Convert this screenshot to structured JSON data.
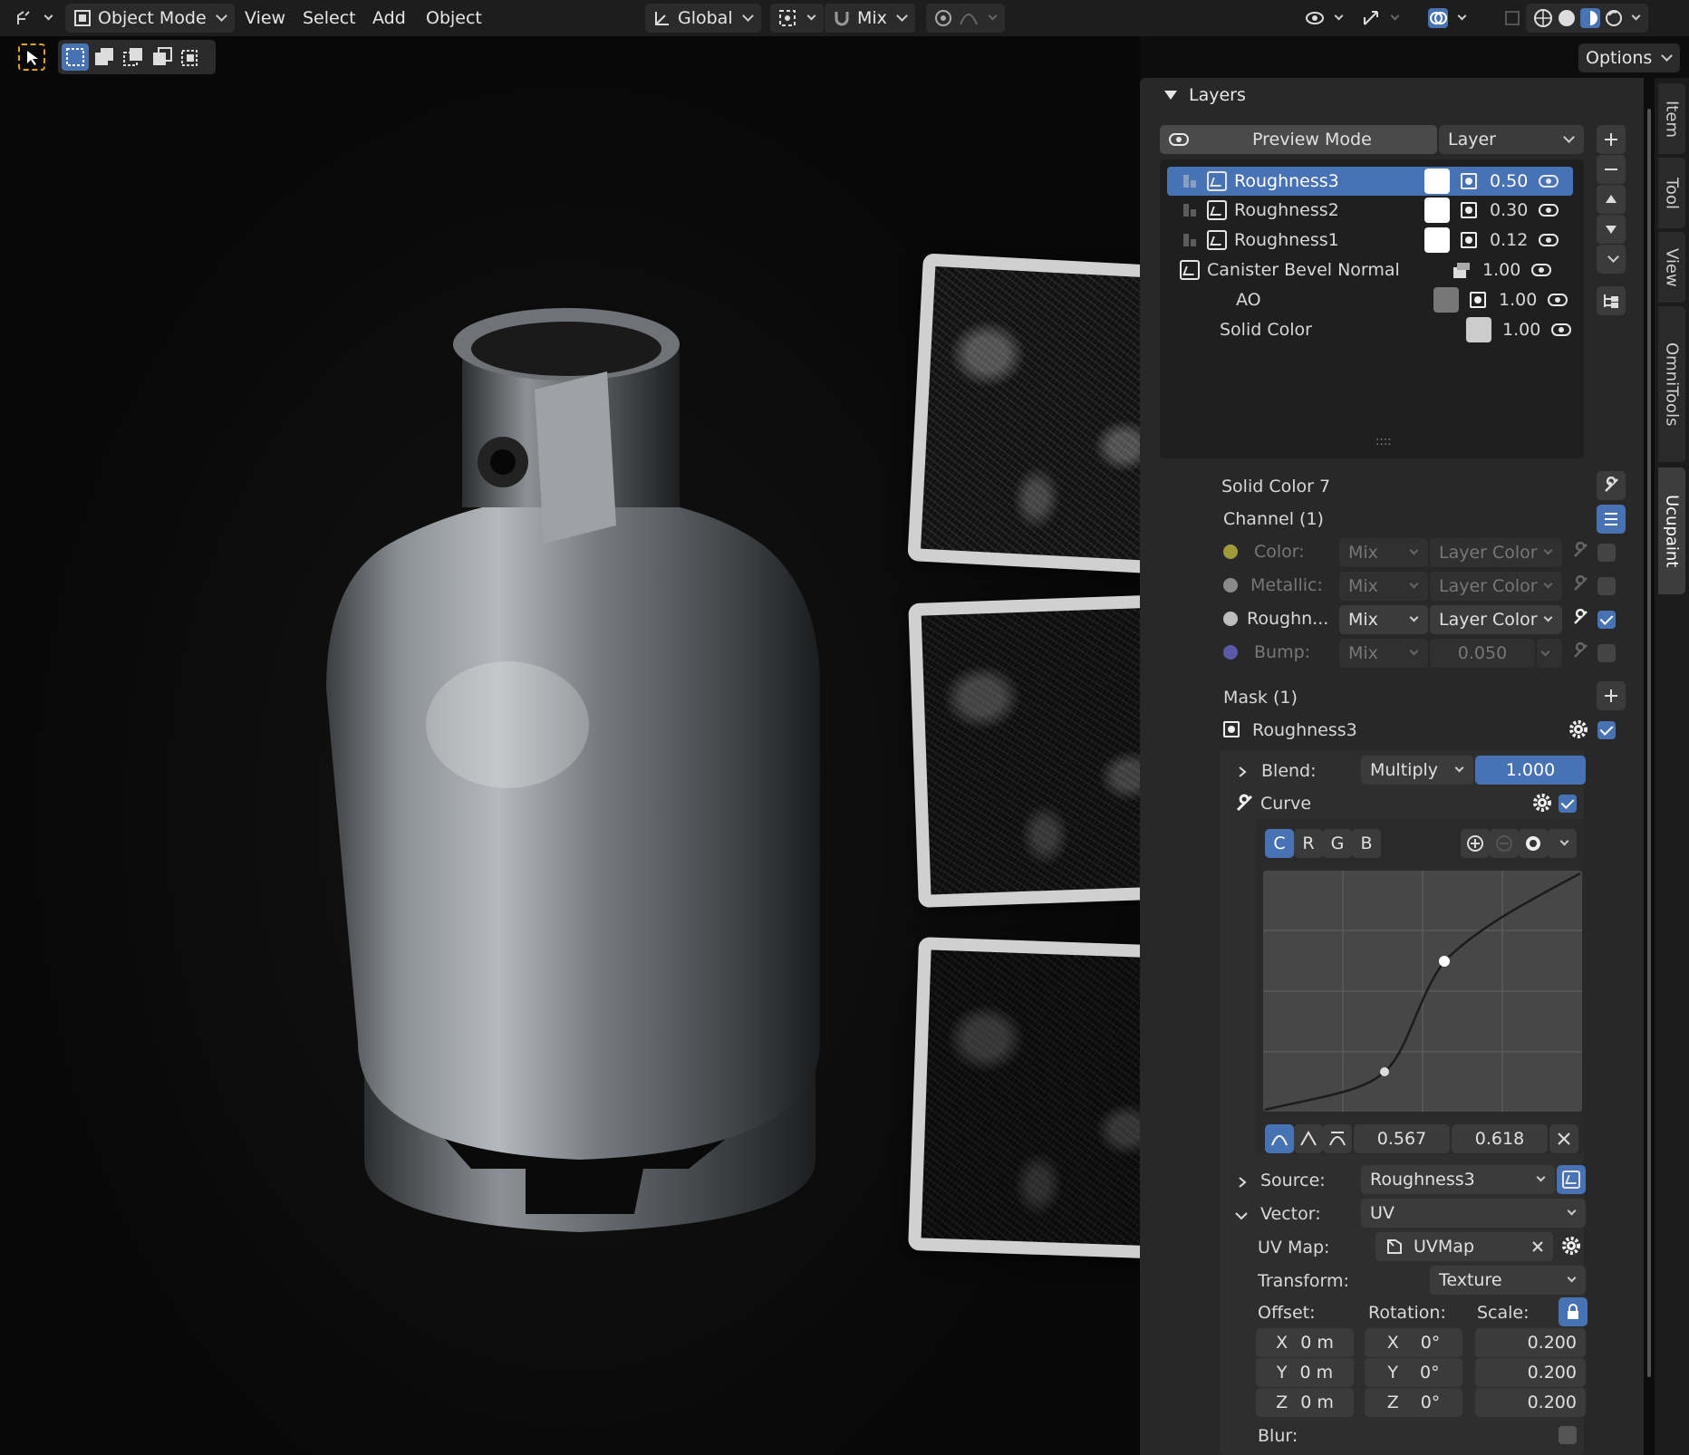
{
  "header": {
    "mode": "Object Mode",
    "menus": [
      "View",
      "Select",
      "Add",
      "Object"
    ],
    "transform_orientation": "Global",
    "snap_blend": "Mix",
    "options_label": "Options"
  },
  "layers_panel": {
    "title": "Layers",
    "preview_mode_label": "Preview Mode",
    "preview_select": "Layer",
    "layers": [
      {
        "name": "Roughness3",
        "opacity": "0.50",
        "selected": true
      },
      {
        "name": "Roughness2",
        "opacity": "0.30",
        "selected": false
      },
      {
        "name": "Roughness1",
        "opacity": "0.12",
        "selected": false
      },
      {
        "name": "Canister Bevel Normal",
        "opacity": "1.00",
        "selected": false
      },
      {
        "name": "AO",
        "opacity": "1.00",
        "selected": false
      },
      {
        "name": "Solid Color",
        "opacity": "1.00",
        "selected": false
      }
    ],
    "active_layer_name": "Solid Color 7",
    "channel_header": "Channel (1)",
    "channels": [
      {
        "label": "Color:",
        "blend": "Mix",
        "source": "Layer Color",
        "enabled": false,
        "color": "#a09a3a"
      },
      {
        "label": "Metallic:",
        "blend": "Mix",
        "source": "Layer Color",
        "enabled": false,
        "color": "#8a8a8a"
      },
      {
        "label": "Roughn...",
        "blend": "Mix",
        "source": "Layer Color",
        "enabled": true,
        "color": "#bdbdbd"
      },
      {
        "label": "Bump:",
        "blend": "Mix",
        "source": "0.050",
        "enabled": false,
        "color": "#5a5aa8"
      }
    ],
    "mask_header": "Mask (1)",
    "mask_name": "Roughness3",
    "blend_label": "Blend:",
    "blend_mode": "Multiply",
    "blend_value": "1.000",
    "curve_label": "Curve",
    "curve_channels": [
      "C",
      "R",
      "G",
      "B"
    ],
    "curve_point_x": "0.567",
    "curve_point_y": "0.618",
    "source_label": "Source:",
    "source_value": "Roughness3",
    "vector_label": "Vector:",
    "vector_value": "UV",
    "uvmap_label": "UV Map:",
    "uvmap_value": "UVMap",
    "transform_label": "Transform:",
    "transform_value": "Texture",
    "offset_label": "Offset:",
    "rotation_label": "Rotation:",
    "scale_label": "Scale:",
    "offset": [
      {
        "axis": "X",
        "value": "0 m"
      },
      {
        "axis": "Y",
        "value": "0 m"
      },
      {
        "axis": "Z",
        "value": "0 m"
      }
    ],
    "rotation": [
      {
        "axis": "X",
        "value": "0°"
      },
      {
        "axis": "Y",
        "value": "0°"
      },
      {
        "axis": "Z",
        "value": "0°"
      }
    ],
    "scale": [
      "0.200",
      "0.200",
      "0.200"
    ],
    "blur_label": "Blur:"
  },
  "sidebar_tabs": [
    "Item",
    "Tool",
    "View",
    "OmniTools",
    "Ucupaint"
  ],
  "colors": {
    "accent": "#4772b3",
    "panel": "#282828",
    "header": "#1d1d1d"
  }
}
